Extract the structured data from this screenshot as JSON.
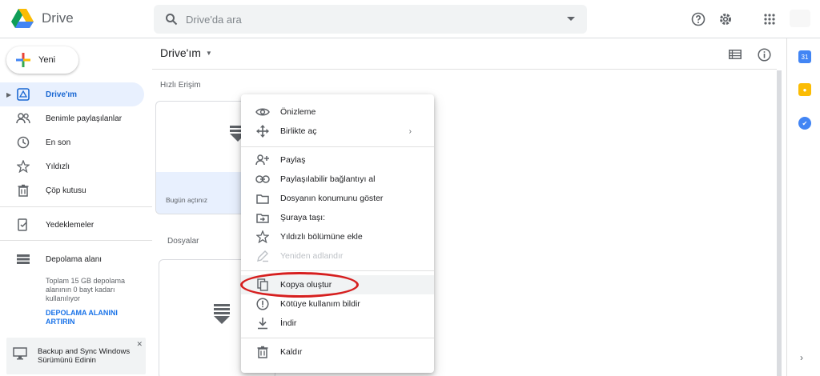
{
  "app": {
    "name": "Drive"
  },
  "search": {
    "placeholder": "Drive'da ara"
  },
  "sidebar": {
    "new_label": "Yeni",
    "items": [
      {
        "label": "Drive'ım",
        "icon": "drive-icon"
      },
      {
        "label": "Benimle paylaşılanlar",
        "icon": "people-icon"
      },
      {
        "label": "En son",
        "icon": "clock-icon"
      },
      {
        "label": "Yıldızlı",
        "icon": "star-icon"
      },
      {
        "label": "Çöp kutusu",
        "icon": "trash-icon"
      },
      {
        "label": "Yedeklemeler",
        "icon": "backup-icon"
      },
      {
        "label": "Depolama alanı",
        "icon": "storage-icon"
      }
    ],
    "storage_text": "Toplam 15 GB depolama alanının 0 bayt kadarı kullanılıyor",
    "storage_link": "DEPOLAMA ALANINI ARTIRIN",
    "backup_banner": "Backup and Sync Windows Sürümünü Edinin"
  },
  "main": {
    "title": "Drive'ım",
    "quick_access_label": "Hızlı Erişim",
    "quick_card_sub": "Bugün açtınız",
    "files_label": "Dosyalar"
  },
  "context_menu": {
    "items": [
      {
        "label": "Önizleme",
        "icon": "eye-icon"
      },
      {
        "label": "Birlikte aç",
        "icon": "move-icon",
        "submenu": true
      },
      {
        "label": "Paylaş",
        "icon": "person-add-icon"
      },
      {
        "label": "Paylaşılabilir bağlantıyı al",
        "icon": "link-icon"
      },
      {
        "label": "Dosyanın konumunu göster",
        "icon": "folder-icon"
      },
      {
        "label": "Şuraya taşı:",
        "icon": "folder-move-icon"
      },
      {
        "label": "Yıldızlı bölümüne ekle",
        "icon": "star-icon"
      },
      {
        "label": "Yeniden adlandır",
        "icon": "pencil-icon",
        "disabled": true
      },
      {
        "label": "Kopya oluştur",
        "icon": "copy-icon",
        "highlighted": true
      },
      {
        "label": "Kötüye kullanım bildir",
        "icon": "report-icon"
      },
      {
        "label": "İndir",
        "icon": "download-icon"
      },
      {
        "label": "Kaldır",
        "icon": "trash-icon"
      }
    ]
  },
  "colors": {
    "accent": "#1a73e8",
    "highlight_circle": "#d61f1f",
    "active_bg": "#e8f0fe"
  }
}
